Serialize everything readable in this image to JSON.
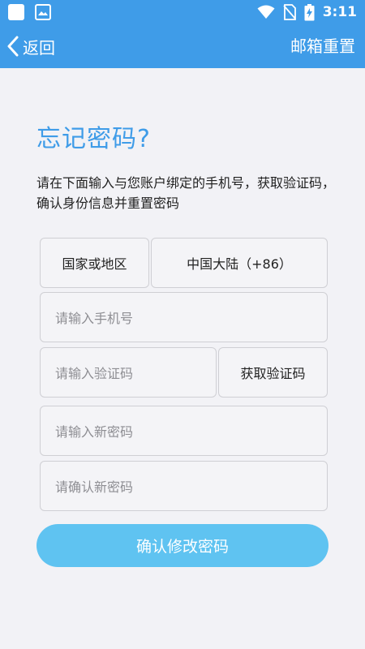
{
  "status_bar": {
    "time": "3:11",
    "icons": [
      "app-icon",
      "image-icon",
      "wifi-icon",
      "no-sim-icon",
      "battery-charging-icon"
    ]
  },
  "app_bar": {
    "back_label": "返回",
    "right_action": "邮箱重置",
    "background": "#3f9ce8"
  },
  "main": {
    "title": "忘记密码?",
    "description": "请在下面输入与您账户绑定的手机号，获取验证码，确认身份信息并重置密码",
    "country_label": "国家或地区",
    "country_value": "中国大陆（+86）",
    "phone_placeholder": "请输入手机号",
    "code_placeholder": "请输入验证码",
    "get_code_label": "获取验证码",
    "new_password_placeholder": "请输入新密码",
    "confirm_password_placeholder": "请确认新密码",
    "confirm_button": "确认修改密码"
  },
  "colors": {
    "accent": "#3f9ce8",
    "button": "#5fc3f1",
    "background": "#f2f2f6"
  }
}
